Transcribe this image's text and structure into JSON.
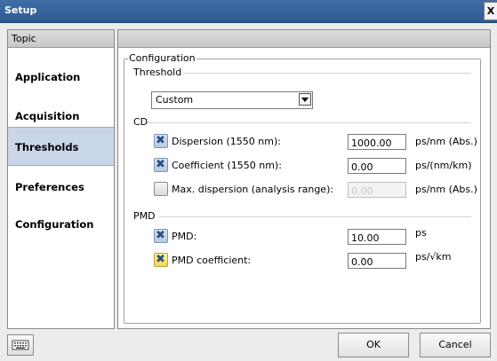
{
  "window": {
    "title": "Setup",
    "close_glyph": "X"
  },
  "topics": {
    "header": "Topic",
    "items": [
      {
        "label": "Application"
      },
      {
        "label": "Acquisition"
      },
      {
        "label": "Thresholds",
        "selected": true
      },
      {
        "label": "Preferences"
      },
      {
        "label": "Configuration"
      }
    ]
  },
  "config": {
    "legend": "Configuration",
    "threshold": {
      "label": "Threshold",
      "dropdown_value": "Custom"
    },
    "cd": {
      "label": "CD",
      "rows": [
        {
          "label": "Dispersion (1550 nm):",
          "checked": true,
          "value": "1000.00",
          "unit": "ps/nm (Abs.)",
          "enabled": true
        },
        {
          "label": "Coefficient (1550 nm):",
          "checked": true,
          "value": "0.00",
          "unit": "ps/(nm/km)",
          "enabled": true
        },
        {
          "label": "Max. dispersion (analysis range):",
          "checked": false,
          "value": "0.00",
          "unit": "ps/nm (Abs.)",
          "enabled": false
        }
      ]
    },
    "pmd": {
      "label": "PMD",
      "rows": [
        {
          "label": "PMD:",
          "checked": true,
          "value": "10.00",
          "unit": "ps",
          "enabled": true
        },
        {
          "label": "PMD coefficient:",
          "checked": true,
          "value": "0.00",
          "unit": "ps/√km",
          "enabled": true
        }
      ]
    }
  },
  "buttons": {
    "ok": "OK",
    "cancel": "Cancel"
  },
  "icons": {
    "keyboard": "keyboard-icon",
    "checkbox_mark": "x-mark-icon"
  },
  "colors": {
    "titlebar": "#2c5a91",
    "selected_topic": "#c9d6e8",
    "checked_box": "#b9c9df",
    "focused_checkbox": "#f0d850"
  }
}
